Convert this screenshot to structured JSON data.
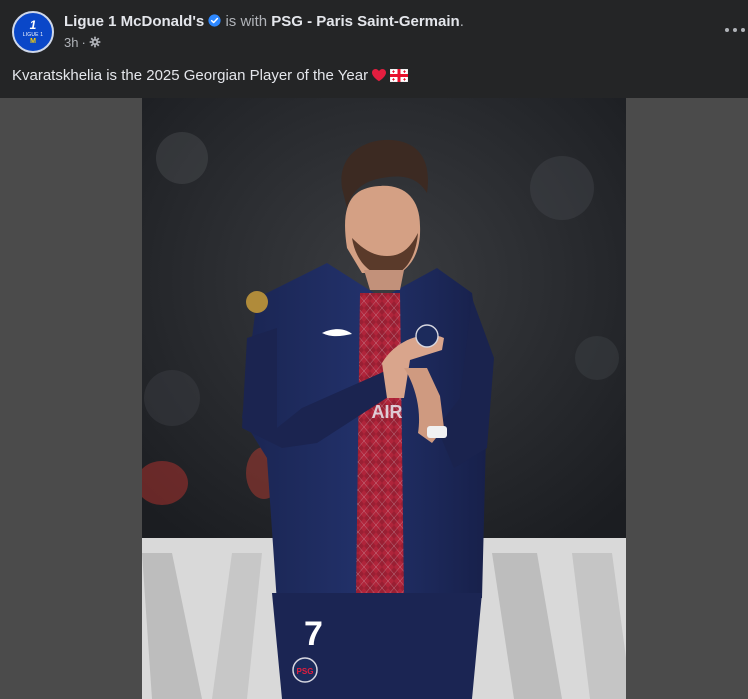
{
  "page": {
    "author": "Ligue 1 McDonald's",
    "with_text": "is with",
    "tagged_page": "PSG - Paris Saint-Germain",
    "tagged_suffix": ".",
    "timestamp": "3h",
    "separator": "·",
    "caption": "Kvaratskhelia is the 2025 Georgian Player of the Year",
    "avatar_logo_text": "1",
    "avatar_brand_text": "LIGUE 1",
    "avatar_sponsor_text": "M"
  },
  "icons": {
    "verified": "verified-badge-icon",
    "privacy": "gear-icon",
    "more": "more-options-icon",
    "heart": "red-heart-emoji",
    "flag": "georgia-flag-emoji"
  },
  "photo": {
    "jersey_number": "7",
    "jersey_sponsor": "AIR",
    "crest_text": "PSG"
  },
  "colors": {
    "background": "#242526",
    "text_primary": "#e4e6eb",
    "text_secondary": "#b0b3b8",
    "verified": "#2d88ff",
    "media_backdrop": "#4b4b4b",
    "jersey_navy": "#1c2b5c",
    "jersey_red": "#b0243a"
  }
}
